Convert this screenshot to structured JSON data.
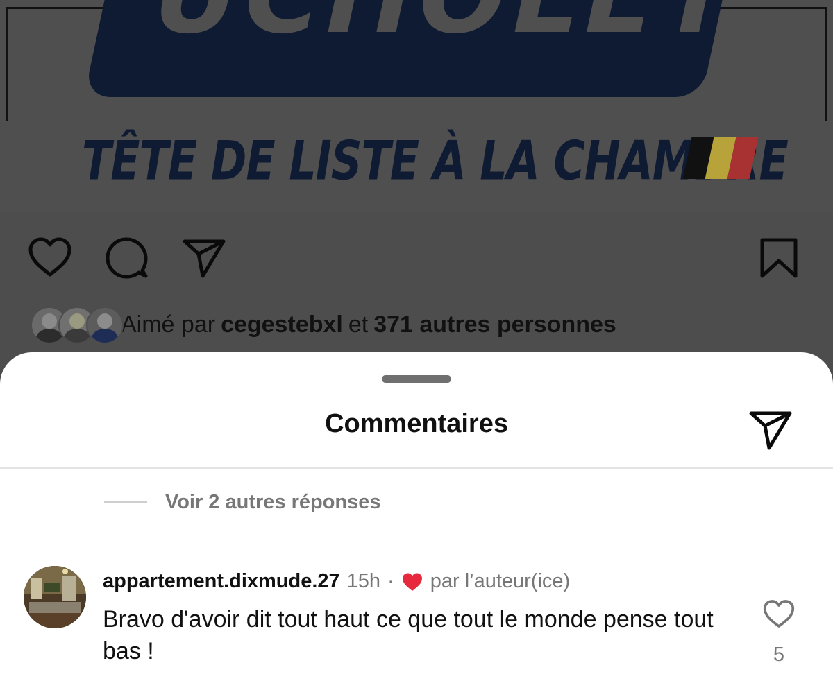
{
  "post": {
    "banner_text": "UCHOLET",
    "subtitle": "TÊTE DE LISTE À LA CHAMBRE",
    "flag_colors": [
      "#111111",
      "#b8a33a",
      "#a83232"
    ],
    "actions": {
      "like_icon": "heart-outline-icon",
      "comment_icon": "comment-bubble-icon",
      "share_icon": "paper-plane-icon",
      "save_icon": "bookmark-icon"
    },
    "likes": {
      "prefix": "Aimé par",
      "user": "cegestebxl",
      "joiner": "et",
      "others": "371 autres personnes"
    }
  },
  "sheet": {
    "title": "Commentaires",
    "share_icon": "paper-plane-icon",
    "view_replies": "Voir 2 autres réponses"
  },
  "comment": {
    "username": "appartement.dixmude.27",
    "time": "15h",
    "separator": "·",
    "liked_by_author": "par l’auteur(ice)",
    "liked_heart_color": "#e8283c",
    "text": "Bravo d'avoir dit tout haut ce que tout le monde pense tout bas !",
    "like_count": "5"
  }
}
